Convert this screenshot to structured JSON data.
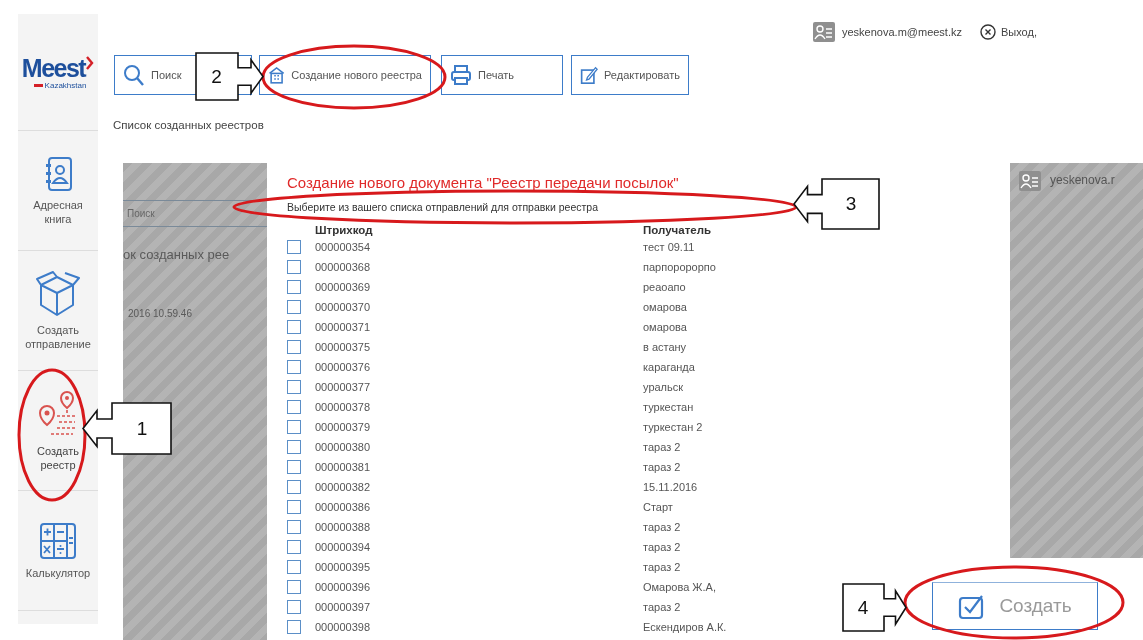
{
  "sidebar": {
    "logo": {
      "brand": "Meest",
      "region": "Kazakhstan"
    },
    "items": [
      {
        "label": "Адресная книга",
        "selected": false
      },
      {
        "label": "Создать отправление",
        "selected": false
      },
      {
        "label": "Создать реестр",
        "selected": true
      },
      {
        "label": "Калькулятор",
        "selected": false
      }
    ]
  },
  "user": {
    "email": "yeskenova.m@meest.kz",
    "logout": "Выход,"
  },
  "toolbar": [
    {
      "label": "Поиск"
    },
    {
      "label": "Создание нового реестра"
    },
    {
      "label": "Печать"
    },
    {
      "label": "Редактировать"
    }
  ],
  "list_title": "Список созданных реестров",
  "background_page": {
    "search_placeholder": "Поиск",
    "heading": "ок созданных рее",
    "date": "2016 10.59.46",
    "user": "yeskenova.r"
  },
  "dialog": {
    "title": "Создание нового документа \"Реестр передачи посылок\"",
    "subtitle": "Выберите из вашего списка отправлений для отправки реестра",
    "columns": [
      "Штрихкод",
      "Получатель"
    ],
    "rows": [
      {
        "barcode": "000000354",
        "recipient": "тест 09.11",
        "checked": false
      },
      {
        "barcode": "000000368",
        "recipient": "парпоророрпо",
        "checked": false
      },
      {
        "barcode": "000000369",
        "recipient": "реаоапо",
        "checked": false
      },
      {
        "barcode": "000000370",
        "recipient": "омарова",
        "checked": false
      },
      {
        "barcode": "000000371",
        "recipient": "омарова",
        "checked": false
      },
      {
        "barcode": "000000375",
        "recipient": "в астану",
        "checked": false
      },
      {
        "barcode": "000000376",
        "recipient": "караганда",
        "checked": false
      },
      {
        "barcode": "000000377",
        "recipient": "уральск",
        "checked": false
      },
      {
        "barcode": "000000378",
        "recipient": "туркестан",
        "checked": false
      },
      {
        "barcode": "000000379",
        "recipient": "туркестан 2",
        "checked": false
      },
      {
        "barcode": "000000380",
        "recipient": "тараз 2",
        "checked": false
      },
      {
        "barcode": "000000381",
        "recipient": "тараз 2",
        "checked": false
      },
      {
        "barcode": "000000382",
        "recipient": "15.11.2016",
        "checked": false
      },
      {
        "barcode": "000000386",
        "recipient": "Старт",
        "checked": false
      },
      {
        "barcode": "000000388",
        "recipient": "тараз 2",
        "checked": false
      },
      {
        "barcode": "000000394",
        "recipient": "тараз 2",
        "checked": false
      },
      {
        "barcode": "000000395",
        "recipient": "тараз 2",
        "checked": false
      },
      {
        "barcode": "000000396",
        "recipient": "Омарова Ж.А,",
        "checked": false
      },
      {
        "barcode": "000000397",
        "recipient": "тараз 2",
        "checked": false
      },
      {
        "barcode": "000000398",
        "recipient": "Ескендиров А.К.",
        "checked": false
      }
    ],
    "create_button": "Создать"
  },
  "annotations": [
    {
      "kind": "callout",
      "label": "2"
    },
    {
      "kind": "callout",
      "label": "1"
    },
    {
      "kind": "callout",
      "label": "3"
    },
    {
      "kind": "callout",
      "label": "4"
    }
  ]
}
